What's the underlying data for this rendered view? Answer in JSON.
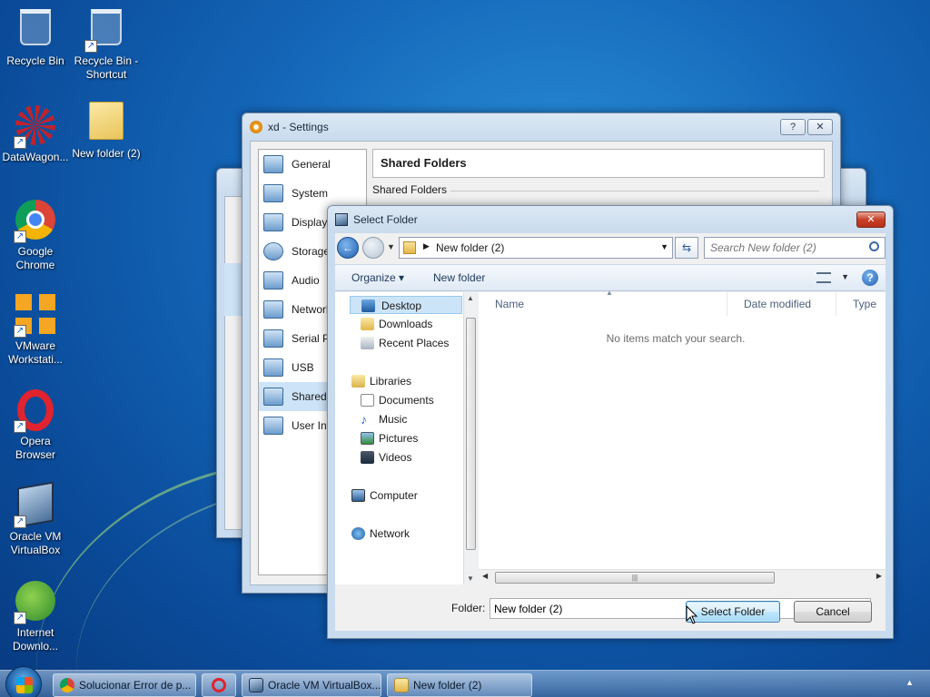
{
  "desktop": {
    "icons": [
      {
        "label": "Recycle Bin"
      },
      {
        "label": "Recycle Bin - Shortcut"
      },
      {
        "label": "DataWagon..."
      },
      {
        "label": "New folder (2)"
      },
      {
        "label": "Google Chrome"
      },
      {
        "label": "VMware Workstati..."
      },
      {
        "label": "Opera Browser"
      },
      {
        "label": "Oracle VM VirtualBox"
      },
      {
        "label": "Internet Downlo..."
      }
    ]
  },
  "settings_window": {
    "title": "xd - Settings",
    "help_label": "?",
    "close_label": "✕",
    "items": [
      {
        "label": "General"
      },
      {
        "label": "System"
      },
      {
        "label": "Display"
      },
      {
        "label": "Storage"
      },
      {
        "label": "Audio"
      },
      {
        "label": "Network"
      },
      {
        "label": "Serial Ports"
      },
      {
        "label": "USB"
      },
      {
        "label": "Shared Folders"
      },
      {
        "label": "User Interface"
      }
    ],
    "header": "Shared Folders",
    "section_label": "Shared Folders"
  },
  "dialog": {
    "title": "Select Folder",
    "close_label": "✕",
    "address_path": "New folder (2)",
    "search_placeholder": "Search New folder (2)",
    "toolbar": {
      "organize": "Organize",
      "new_folder": "New folder",
      "help": "?"
    },
    "nav": {
      "favorites": [
        {
          "label": "Desktop"
        },
        {
          "label": "Downloads"
        },
        {
          "label": "Recent Places"
        }
      ],
      "libraries_label": "Libraries",
      "libraries": [
        {
          "label": "Documents"
        },
        {
          "label": "Music"
        },
        {
          "label": "Pictures"
        },
        {
          "label": "Videos"
        }
      ],
      "computer": "Computer",
      "network": "Network"
    },
    "columns": {
      "name": "Name",
      "date_modified": "Date modified",
      "type": "Type"
    },
    "empty_message": "No items match your search.",
    "folder_label": "Folder:",
    "folder_value": "New folder (2)",
    "select_button": "Select Folder",
    "cancel_button": "Cancel"
  },
  "taskbar": {
    "buttons": [
      {
        "label": "Solucionar Error de p..."
      },
      {
        "label": "Oracle VM VirtualBox..."
      },
      {
        "label": "New folder (2)"
      }
    ]
  },
  "colors": {
    "accent": "#1f5fb0",
    "selection": "#cce4f7"
  }
}
